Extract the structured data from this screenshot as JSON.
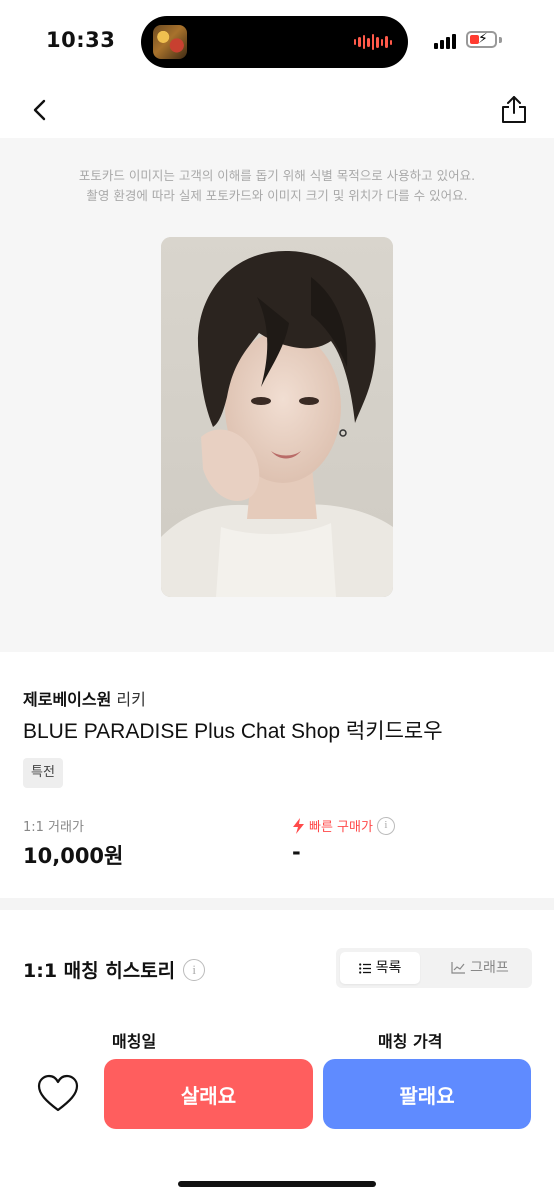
{
  "status_bar": {
    "time": "10:33"
  },
  "disclaimer": {
    "line1": "포토카드 이미지는 고객의 이해를 돕기 위해 식별 목적으로 사용하고 있어요.",
    "line2": "촬영 환경에 따라 실제 포토카드와 이미지 크기 및 위치가 다를 수 있어요."
  },
  "product": {
    "group": "제로베이스원",
    "member": "리키",
    "title": "BLUE PARADISE Plus Chat Shop 럭키드로우",
    "tag": "특전"
  },
  "price": {
    "trade_label": "1:1 거래가",
    "trade_value": "10,000원",
    "quick_label": "빠른 구매가",
    "quick_value": "-"
  },
  "history": {
    "title": "1:1 매칭 히스토리",
    "tab_list": "목록",
    "tab_graph": "그래프",
    "col_date": "매칭일",
    "col_price": "매칭 가격"
  },
  "actions": {
    "buy_label": "살래요",
    "sell_label": "팔래요"
  },
  "colors": {
    "buy": "#ff5e5e",
    "sell": "#5f8bff",
    "quick_price": "#ff4a4a"
  }
}
